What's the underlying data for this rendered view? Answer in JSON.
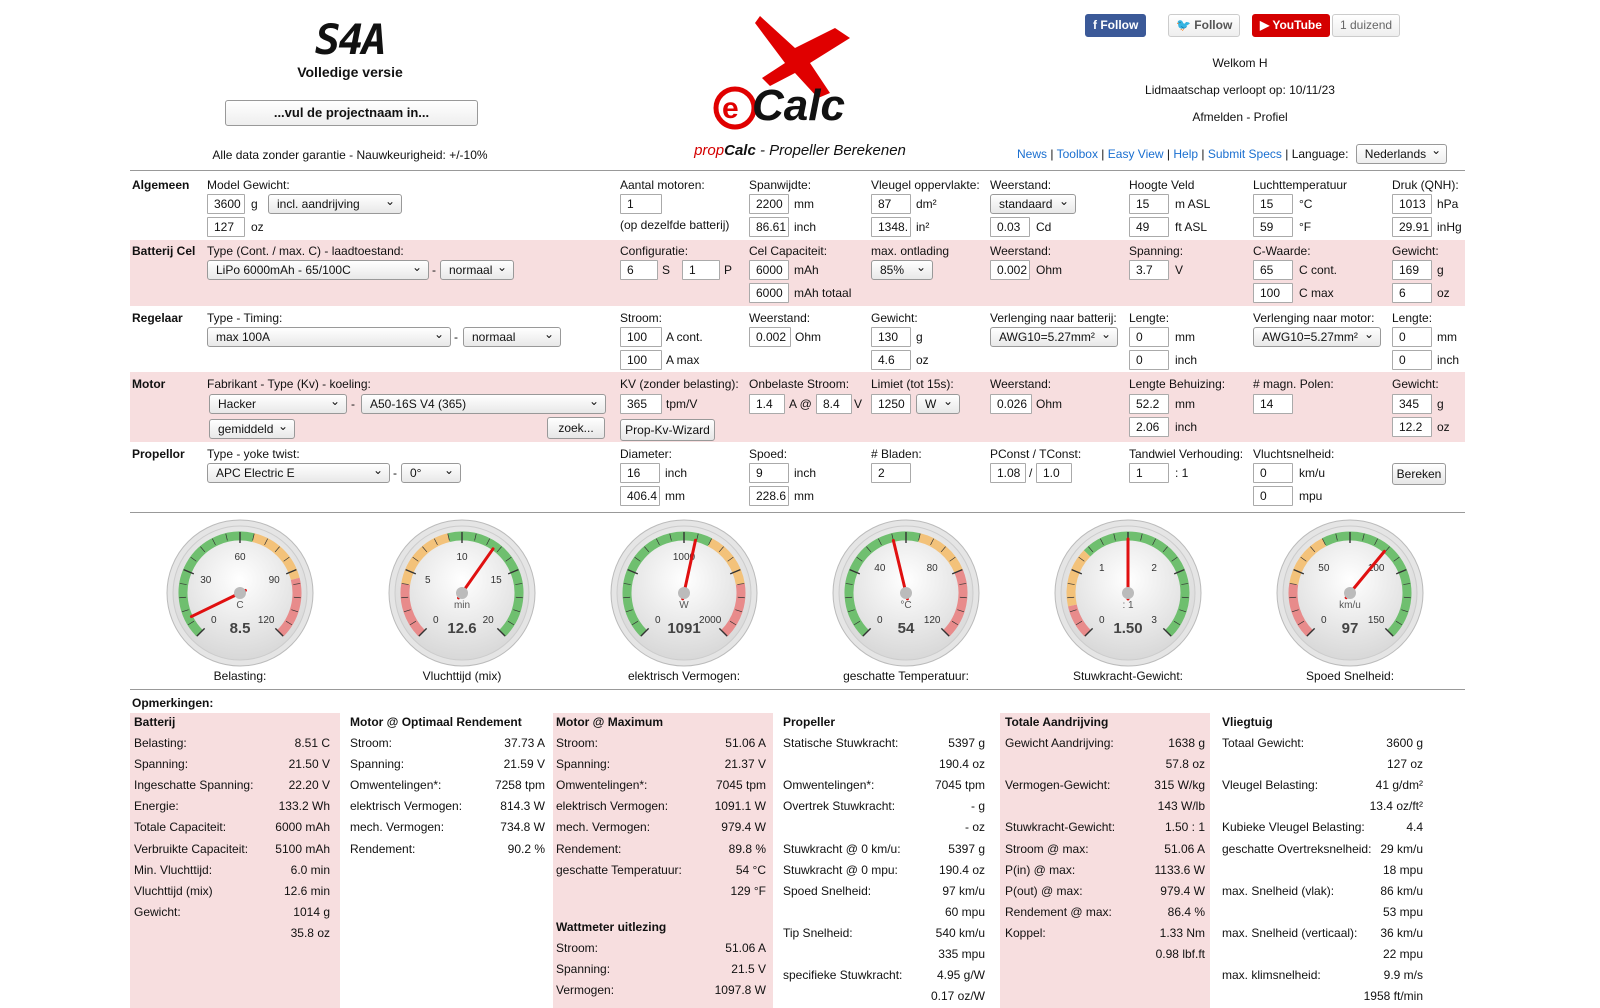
{
  "header": {
    "logo_text": "S4A",
    "version": "Volledige versie",
    "project_placeholder": "...vul de projectnaam in...",
    "disclaimer": "Alle data zonder garantie - Nauwkeurigheid: +/-10%",
    "brand": "eCalc",
    "subtitle_prefix": "prop",
    "subtitle_bold": "Calc",
    "subtitle_rest": " - Propeller Berekenen"
  },
  "social": {
    "facebook": "Follow",
    "twitter": "Follow",
    "youtube": "YouTube",
    "youtube_count": "1 duizend"
  },
  "user": {
    "welcome": "Welkom H",
    "membership": "Lidmaatschap verloopt op: 10/11/23",
    "links": "Afmelden - Profiel"
  },
  "nav": {
    "news": "News",
    "toolbox": "Toolbox",
    "easy_view": "Easy View",
    "help": "Help",
    "submit": "Submit Specs",
    "language_label": "Language:",
    "language": "Nederlands"
  },
  "form": {
    "algemeen": {
      "title": "Algemeen",
      "model_weight_label": "Model Gewicht:",
      "weight_g": "3600",
      "unit_g": "g",
      "weight_mode": "incl. aandrijving",
      "weight_oz": "127",
      "unit_oz": "oz",
      "motors_label": "Aantal motoren:",
      "motors": "1",
      "motors_note": "(op dezelfde batterij)",
      "span_label": "Spanwijdte:",
      "span_mm": "2200",
      "unit_mm": "mm",
      "span_inch": "86.61",
      "unit_inch": "inch",
      "wing_area_label": "Vleugel oppervlakte:",
      "area_dm": "87",
      "unit_dm": "dm²",
      "area_in": "1348.",
      "unit_in": "in²",
      "drag_label": "Weerstand:",
      "drag_sel": "standaard",
      "cd": "0.03",
      "unit_cd": "Cd",
      "field_label": "Hoogte Veld",
      "field_m": "15",
      "unit_masl": "m ASL",
      "field_ft": "49",
      "unit_ftasl": "ft ASL",
      "temp_label": "Luchttemperatuur",
      "temp_c": "15",
      "unit_c": "°C",
      "temp_f": "59",
      "unit_f": "°F",
      "press_label": "Druk (QNH):",
      "press_hpa": "1013",
      "unit_hpa": "hPa",
      "press_inhg": "29.91",
      "unit_inhg": "inHg"
    },
    "batterij": {
      "title": "Batterij Cel",
      "type_label": "Type (Cont. / max. C) - laadtoestand:",
      "type": "LiPo 6000mAh - 65/100C",
      "state": "normaal",
      "config_label": "Configuratie:",
      "s": "6",
      "unit_s": "S",
      "p": "1",
      "unit_p": "P",
      "cap_label": "Cel Capaciteit:",
      "cap": "6000",
      "unit_mah": "mAh",
      "cap_total": "6000",
      "unit_mah_total": "mAh totaal",
      "disch_label": "max. ontlading",
      "disch": "85%",
      "res_label": "Weerstand:",
      "res": "0.002",
      "unit_ohm": "Ohm",
      "volt_label": "Spanning:",
      "volt": "3.7",
      "unit_v": "V",
      "c_label": "C-Waarde:",
      "c_cont": "65",
      "unit_ccont": "C cont.",
      "c_max": "100",
      "unit_cmax": "C max",
      "w_label": "Gewicht:",
      "w_g": "169",
      "unit_g": "g",
      "w_oz": "6",
      "unit_oz": "oz"
    },
    "regelaar": {
      "title": "Regelaar",
      "type_label": "Type - Timing:",
      "type": "max 100A",
      "timing": "normaal",
      "cur_label": "Stroom:",
      "cur_cont": "100",
      "unit_acont": "A cont.",
      "cur_max": "100",
      "unit_amax": "A max",
      "res_label": "Weerstand:",
      "res": "0.002",
      "unit_ohm": "Ohm",
      "w_label": "Gewicht:",
      "w_g": "130",
      "unit_g": "g",
      "w_oz": "4.6",
      "unit_oz": "oz",
      "ext_batt_label": "Verlenging naar batterij:",
      "ext_batt": "AWG10=5.27mm²",
      "len1_label": "Lengte:",
      "len1_mm": "0",
      "unit_mm": "mm",
      "len1_in": "0",
      "unit_inch": "inch",
      "ext_mot_label": "Verlenging naar motor:",
      "ext_mot": "AWG10=5.27mm²",
      "len2_label": "Lengte:",
      "len2_mm": "0",
      "len2_in": "0"
    },
    "motor": {
      "title": "Motor",
      "type_label": "Fabrikant - Type (Kv) - koeling:",
      "maker": "Hacker",
      "model": "A50-16S V4 (365)",
      "cooling": "gemiddeld",
      "search": "zoek...",
      "kv_label": "KV (zonder belasting):",
      "kv": "365",
      "unit_kv": "tpm/V",
      "wizard": "Prop-Kv-Wizard",
      "noload_label": "Onbelaste Stroom:",
      "noload_a": "1.4",
      "unit_a_at": "A @",
      "noload_v": "8.4",
      "unit_v": "V",
      "limit_label": "Limiet (tot 15s):",
      "limit": "1250",
      "limit_unit": "W",
      "res_label": "Weerstand:",
      "res": "0.026",
      "unit_ohm": "Ohm",
      "case_label": "Lengte Behuizing:",
      "case_mm": "52.2",
      "unit_mm": "mm",
      "case_in": "2.06",
      "unit_inch": "inch",
      "poles_label": "# magn. Polen:",
      "poles": "14",
      "w_label": "Gewicht:",
      "w_g": "345",
      "unit_g": "g",
      "w_oz": "12.2",
      "unit_oz": "oz"
    },
    "propellor": {
      "title": "Propellor",
      "type_label": "Type - yoke twist:",
      "type": "APC Electric E",
      "twist": "0°",
      "dia_label": "Diameter:",
      "dia_in": "16",
      "unit_inch": "inch",
      "dia_mm": "406.4",
      "unit_mm": "mm",
      "pitch_label": "Spoed:",
      "pitch_in": "9",
      "pitch_mm": "228.6",
      "blades_label": "# Bladen:",
      "blades": "2",
      "pconst_label": "PConst / TConst:",
      "pconst": "1.08",
      "slash": "/",
      "tconst": "1.0",
      "gear_label": "Tandwiel Verhouding:",
      "gear": "1",
      "gear_suffix": ": 1",
      "flight_label": "Vluchtsnelheid:",
      "flight_kmh": "0",
      "unit_kmh": "km/u",
      "flight_mph": "0",
      "unit_mph": "mpu",
      "calc": "Bereken"
    }
  },
  "gauges": [
    {
      "label": "Belasting:",
      "value": "8.5",
      "unit": "C",
      "min": 0,
      "max": 120,
      "ticks": [
        "0",
        "30",
        "60",
        "90",
        "120"
      ],
      "needle": 8.5
    },
    {
      "label": "Vluchttijd (mix)",
      "value": "12.6",
      "unit": "min",
      "min": 0,
      "max": 20,
      "ticks": [
        "0",
        "5",
        "10",
        "15",
        "20"
      ],
      "needle": 12.6
    },
    {
      "label": "elektrisch Vermogen:",
      "value": "1091",
      "unit": "W",
      "min": 0,
      "max": 2000,
      "ticks": [
        "0",
        "1000",
        "2000"
      ],
      "needle": 1091
    },
    {
      "label": "geschatte Temperatuur:",
      "value": "54",
      "unit": "°C",
      "min": 0,
      "max": 120,
      "ticks": [
        "0",
        "40",
        "80",
        "120"
      ],
      "needle": 54
    },
    {
      "label": "Stuwkracht-Gewicht:",
      "value": "1.50",
      "unit": ": 1",
      "min": 0,
      "max": 3,
      "ticks": [
        "0",
        "1",
        "2",
        "3"
      ],
      "needle": 1.5
    },
    {
      "label": "Spoed Snelheid:",
      "value": "97",
      "unit": "km/u",
      "min": 0,
      "max": 150,
      "ticks": [
        "0",
        "50",
        "100",
        "150"
      ],
      "needle": 97
    }
  ],
  "results": {
    "remarks": "Opmerkingen:",
    "batterij": {
      "title": "Batterij",
      "rows": [
        [
          "Belasting:",
          "8.51 C"
        ],
        [
          "Spanning:",
          "21.50 V"
        ],
        [
          "Ingeschatte Spanning:",
          "22.20 V"
        ],
        [
          "Energie:",
          "133.2 Wh"
        ],
        [
          "Totale Capaciteit:",
          "6000 mAh"
        ],
        [
          "Verbruikte Capaciteit:",
          "5100 mAh"
        ],
        [
          "Min. Vluchttijd:",
          "6.0 min"
        ],
        [
          "Vluchttijd (mix)",
          "12.6 min"
        ],
        [
          "Gewicht:",
          "1014 g"
        ],
        [
          "",
          "35.8 oz"
        ]
      ]
    },
    "opt": {
      "title": "Motor @ Optimaal Rendement",
      "rows": [
        [
          "Stroom:",
          "37.73 A"
        ],
        [
          "Spanning:",
          "21.59 V"
        ],
        [
          "Omwentelingen*:",
          "7258 tpm"
        ],
        [
          "elektrisch Vermogen:",
          "814.3 W"
        ],
        [
          "mech. Vermogen:",
          "734.8 W"
        ],
        [
          "Rendement:",
          "90.2 %"
        ]
      ]
    },
    "max": {
      "title": "Motor @ Maximum",
      "rows": [
        [
          "Stroom:",
          "51.06 A"
        ],
        [
          "Spanning:",
          "21.37 V"
        ],
        [
          "Omwentelingen*:",
          "7045 tpm"
        ],
        [
          "elektrisch Vermogen:",
          "1091.1 W"
        ],
        [
          "mech. Vermogen:",
          "979.4 W"
        ],
        [
          "Rendement:",
          "89.8 %"
        ],
        [
          "geschatte Temperatuur:",
          "54 °C"
        ],
        [
          "",
          "129 °F"
        ]
      ]
    },
    "watt": {
      "title": "Wattmeter uitlezing",
      "rows": [
        [
          "Stroom:",
          "51.06 A"
        ],
        [
          "Spanning:",
          "21.5 V"
        ],
        [
          "Vermogen:",
          "1097.8 W"
        ]
      ]
    },
    "propeller": {
      "title": "Propeller",
      "rows": [
        [
          "Statische Stuwkracht:",
          "5397 g"
        ],
        [
          "",
          "190.4 oz"
        ],
        [
          "Omwentelingen*:",
          "7045 tpm"
        ],
        [
          "Overtrek Stuwkracht:",
          "- g"
        ],
        [
          "",
          "- oz"
        ],
        [
          "Stuwkracht @ 0 km/u:",
          "5397 g"
        ],
        [
          "Stuwkracht @ 0 mpu:",
          "190.4 oz"
        ],
        [
          "Spoed Snelheid:",
          "97 km/u"
        ],
        [
          "",
          "60 mpu"
        ],
        [
          "Tip Snelheid:",
          "540 km/u"
        ],
        [
          "",
          "335 mpu"
        ],
        [
          "specifieke Stuwkracht:",
          "4.95 g/W"
        ],
        [
          "",
          "0.17 oz/W"
        ]
      ]
    },
    "aandrijving": {
      "title": "Totale Aandrijving",
      "rows": [
        [
          "Gewicht Aandrijving:",
          "1638 g"
        ],
        [
          "",
          "57.8 oz"
        ],
        [
          "Vermogen-Gewicht:",
          "315 W/kg"
        ],
        [
          "",
          "143 W/lb"
        ],
        [
          "Stuwkracht-Gewicht:",
          "1.50 : 1"
        ],
        [
          "Stroom @ max:",
          "51.06 A"
        ],
        [
          "P(in) @ max:",
          "1133.6 W"
        ],
        [
          "P(out) @ max:",
          "979.4 W"
        ],
        [
          "Rendement @ max:",
          "86.4 %"
        ],
        [
          "Koppel:",
          "1.33 Nm"
        ],
        [
          "",
          "0.98 lbf.ft"
        ]
      ]
    },
    "vliegtuig": {
      "title": "Vliegtuig",
      "rows": [
        [
          "Totaal Gewicht:",
          "3600 g"
        ],
        [
          "",
          "127 oz"
        ],
        [
          "Vleugel Belasting:",
          "41 g/dm²"
        ],
        [
          "",
          "13.4 oz/ft²"
        ],
        [
          "Kubieke Vleugel Belasting:",
          "4.4"
        ],
        [
          "geschatte Overtreksnelheid:",
          "29 km/u"
        ],
        [
          "",
          "18 mpu"
        ],
        [
          "max. Snelheid (vlak):",
          "86 km/u"
        ],
        [
          "",
          "53 mpu"
        ],
        [
          "max. Snelheid (verticaal):",
          "36 km/u"
        ],
        [
          "",
          "22 mpu"
        ],
        [
          "max. klimsnelheid:",
          "9.9 m/s"
        ],
        [
          "",
          "1958 ft/min"
        ]
      ]
    }
  }
}
